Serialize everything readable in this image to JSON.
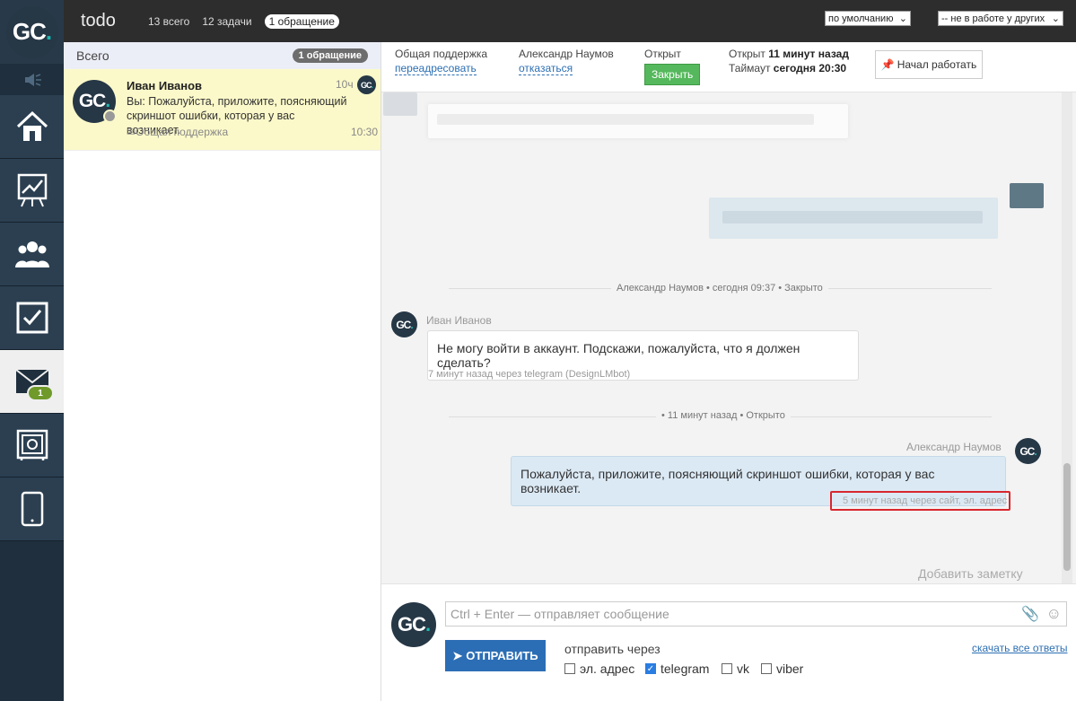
{
  "app": {
    "title": "todo",
    "logo_text": "GC",
    "logo_dot": "."
  },
  "topbar": {
    "tabs": [
      "13 всего",
      "12 задачи",
      "1 обращение"
    ],
    "sort_select": "по умолчанию",
    "filter_select": "-- не в работе у других"
  },
  "sidebar": {
    "nav": [
      {
        "icon": "speaker-icon"
      },
      {
        "icon": "home-icon"
      },
      {
        "icon": "chart-icon"
      },
      {
        "icon": "users-icon"
      },
      {
        "icon": "checkbox-icon"
      },
      {
        "icon": "mail-icon",
        "badge": "1",
        "active": true
      },
      {
        "icon": "safe-icon"
      },
      {
        "icon": "mobile-icon"
      }
    ]
  },
  "list": {
    "header": "Всего",
    "count": "1 обращение",
    "item": {
      "name": "Иван Иванов",
      "message": "Вы: Пожалуйста, приложите, поясняющий скриншот ошибки, которая у вас возникает.",
      "department": "Общая поддержка",
      "time_ago": "10ч",
      "time": "10:30",
      "avatar": "GC"
    }
  },
  "info": {
    "department": "Общая поддержка",
    "forward": "переадресовать",
    "agent": "Александр Наумов",
    "refuse": "отказаться",
    "status": "Открыт",
    "close_button": "Закрыть",
    "opened_label": "Открыт",
    "opened_value": "11 минут назад",
    "timeout_label": "Таймаут",
    "timeout_value": "сегодня 20:30",
    "start_button": "Начал работать"
  },
  "chat": {
    "separator1": "Александр Наумов • сегодня 09:37 • Закрыто",
    "msg1": {
      "author": "Иван Иванов",
      "text": "Не могу войти в аккаунт. Подскажи, пожалуйста, что я должен сделать?",
      "meta": "7 минут назад через telegram (DesignLMbot)"
    },
    "separator2": "• 11 минут назад • Открыто",
    "msg2": {
      "author": "Александр Наумов",
      "text": "Пожалуйста, приложите, поясняющий скриншот ошибки, которая у вас возникает.",
      "meta": "5 минут назад через сайт, эл. адрес"
    },
    "add_note": "Добавить заметку"
  },
  "composer": {
    "placeholder": "Ctrl + Enter — отправляет сообщение",
    "send": "ОТПРАВИТЬ",
    "send_via": "отправить через",
    "download": "скачать все ответы",
    "channels": [
      {
        "label": "эл. адрес",
        "checked": false
      },
      {
        "label": "telegram",
        "checked": true
      },
      {
        "label": "vk",
        "checked": false
      },
      {
        "label": "viber",
        "checked": false
      }
    ]
  },
  "colors": {
    "rail": "#1f2f3d",
    "accent": "#2c6eb5",
    "close_green": "#55b85c",
    "highlight": "#d9272e"
  }
}
